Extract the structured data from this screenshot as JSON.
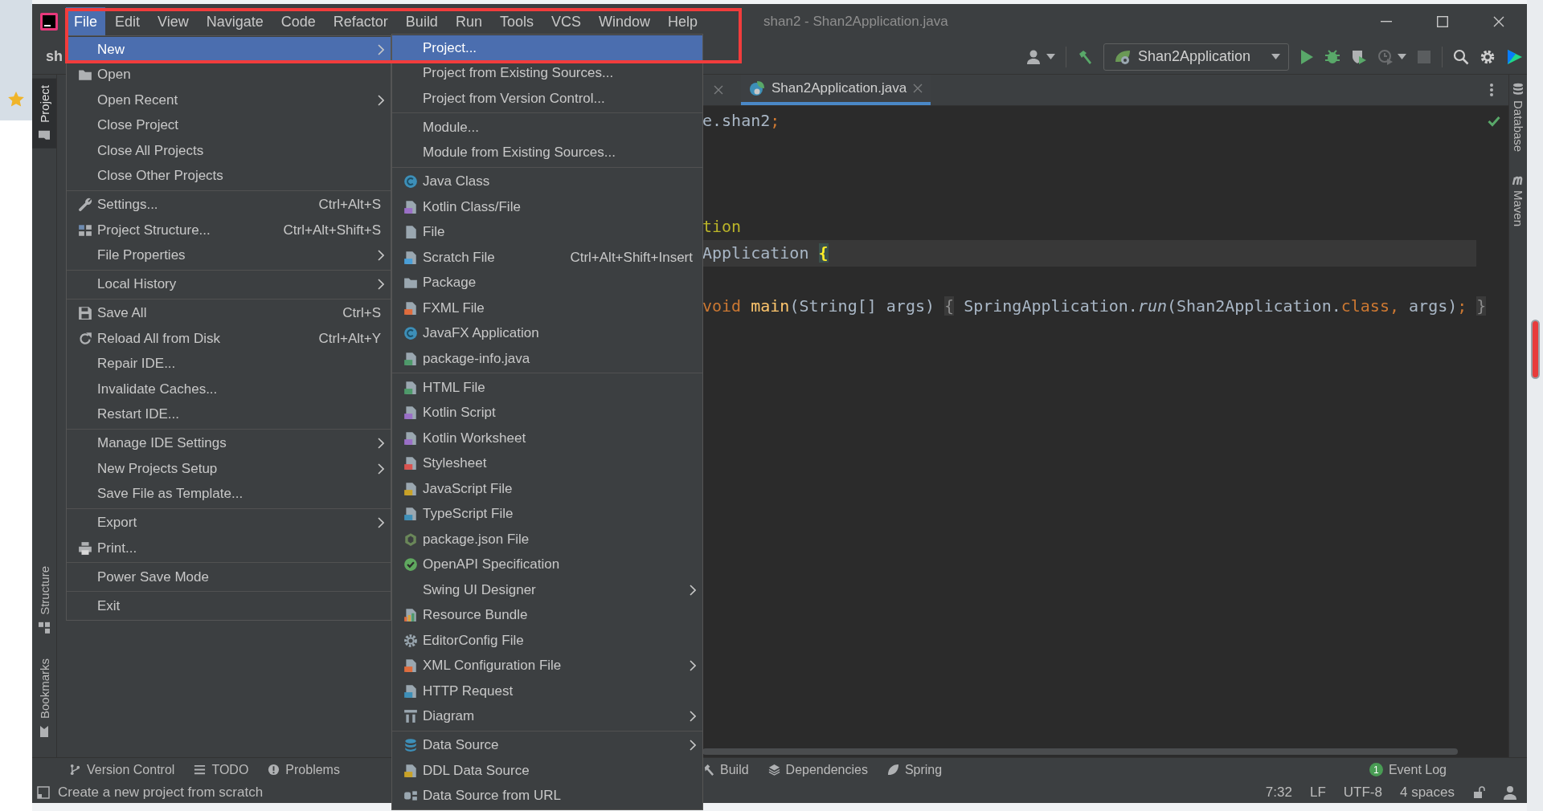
{
  "window": {
    "title": "shan2 - Shan2Application.java"
  },
  "menu_bar": [
    {
      "label": "File",
      "selected": true
    },
    {
      "label": "Edit",
      "selected": false
    },
    {
      "label": "View",
      "selected": false
    },
    {
      "label": "Navigate",
      "selected": false
    },
    {
      "label": "Code",
      "selected": false
    },
    {
      "label": "Refactor",
      "selected": false
    },
    {
      "label": "Build",
      "selected": false
    },
    {
      "label": "Run",
      "selected": false
    },
    {
      "label": "Tools",
      "selected": false
    },
    {
      "label": "VCS",
      "selected": false
    },
    {
      "label": "Window",
      "selected": false
    },
    {
      "label": "Help",
      "selected": false
    }
  ],
  "toolbar": {
    "project": "sh",
    "run_configuration": "Shan2Application"
  },
  "left_stripe": [
    {
      "label": "Project",
      "selected": true
    },
    {
      "label": "Structure",
      "selected": false
    },
    {
      "label": "Bookmarks",
      "selected": false
    }
  ],
  "right_stripe": [
    {
      "label": "Database"
    },
    {
      "label": "Maven"
    }
  ],
  "tabs": [
    {
      "label": "Shan2Application.java",
      "selected": true
    }
  ],
  "editor": {
    "lines": [
      {
        "current": false,
        "tokens": [
          {
            "text": "e.shan2",
            "kind": "plain"
          },
          {
            "text": ";",
            "kind": "keyword"
          }
        ]
      },
      {
        "current": false
      },
      {
        "current": false
      },
      {
        "current": false
      },
      {
        "current": false,
        "tokens": [
          {
            "text": "tion",
            "kind": "annotation"
          }
        ]
      },
      {
        "current": true,
        "tokens": [
          {
            "text": "Application ",
            "kind": "plain"
          },
          {
            "text": "{",
            "kind": "brace-match"
          }
        ]
      },
      {
        "current": false
      },
      {
        "current": false,
        "tokens": [
          {
            "text": "void ",
            "kind": "keyword"
          },
          {
            "text": "main",
            "kind": "method"
          },
          {
            "text": "(String[] args) ",
            "kind": "plain"
          },
          {
            "text": "{",
            "kind": "fold"
          },
          {
            "text": " SpringApplication.",
            "kind": "plain"
          },
          {
            "text": "run",
            "kind": "italic"
          },
          {
            "text": "(Shan2Application.",
            "kind": "plain"
          },
          {
            "text": "class, ",
            "kind": "keyword"
          },
          {
            "text": "args)",
            "kind": "plain"
          },
          {
            "text": "; ",
            "kind": "keyword"
          },
          {
            "text": "}",
            "kind": "fold"
          }
        ]
      }
    ]
  },
  "file_menu": {
    "items": [
      {
        "kind": "item",
        "label": "New",
        "has_submenu": true,
        "selected": true
      },
      {
        "kind": "item",
        "label": "Open",
        "has_submenu": false,
        "selected": false
      },
      {
        "kind": "item",
        "label": "Open Recent",
        "has_submenu": true,
        "selected": false
      },
      {
        "kind": "item",
        "label": "Close Project",
        "has_submenu": false,
        "selected": false
      },
      {
        "kind": "item",
        "label": "Close All Projects",
        "has_submenu": false,
        "selected": false
      },
      {
        "kind": "item",
        "label": "Close Other Projects",
        "has_submenu": false,
        "selected": false
      },
      {
        "kind": "separator"
      },
      {
        "kind": "item",
        "label": "Settings...",
        "shortcut": "Ctrl+Alt+S",
        "has_submenu": false,
        "selected": false
      },
      {
        "kind": "item",
        "label": "Project Structure...",
        "shortcut": "Ctrl+Alt+Shift+S",
        "has_submenu": false,
        "selected": false
      },
      {
        "kind": "item",
        "label": "File Properties",
        "has_submenu": true,
        "selected": false
      },
      {
        "kind": "separator"
      },
      {
        "kind": "item",
        "label": "Local History",
        "has_submenu": true,
        "selected": false
      },
      {
        "kind": "separator"
      },
      {
        "kind": "item",
        "label": "Save All",
        "shortcut": "Ctrl+S",
        "has_submenu": false,
        "selected": false
      },
      {
        "kind": "item",
        "label": "Reload All from Disk",
        "shortcut": "Ctrl+Alt+Y",
        "has_submenu": false,
        "selected": false
      },
      {
        "kind": "item",
        "label": "Repair IDE...",
        "has_submenu": false,
        "selected": false
      },
      {
        "kind": "item",
        "label": "Invalidate Caches...",
        "has_submenu": false,
        "selected": false
      },
      {
        "kind": "item",
        "label": "Restart IDE...",
        "has_submenu": false,
        "selected": false
      },
      {
        "kind": "separator"
      },
      {
        "kind": "item",
        "label": "Manage IDE Settings",
        "has_submenu": true,
        "selected": false
      },
      {
        "kind": "item",
        "label": "New Projects Setup",
        "has_submenu": true,
        "selected": false
      },
      {
        "kind": "item",
        "label": "Save File as Template...",
        "has_submenu": false,
        "selected": false
      },
      {
        "kind": "separator"
      },
      {
        "kind": "item",
        "label": "Export",
        "has_submenu": true,
        "selected": false
      },
      {
        "kind": "item",
        "label": "Print...",
        "has_submenu": false,
        "selected": false
      },
      {
        "kind": "separator"
      },
      {
        "kind": "item",
        "label": "Power Save Mode",
        "has_submenu": false,
        "selected": false
      },
      {
        "kind": "separator"
      },
      {
        "kind": "item",
        "label": "Exit",
        "has_submenu": false,
        "selected": false
      }
    ]
  },
  "new_submenu": {
    "items": [
      {
        "kind": "item",
        "label": "Project...",
        "has_submenu": false,
        "selected": true
      },
      {
        "kind": "item",
        "label": "Project from Existing Sources...",
        "has_submenu": false,
        "selected": false
      },
      {
        "kind": "item",
        "label": "Project from Version Control...",
        "has_submenu": false,
        "selected": false
      },
      {
        "kind": "separator"
      },
      {
        "kind": "item",
        "label": "Module...",
        "has_submenu": false,
        "selected": false
      },
      {
        "kind": "item",
        "label": "Module from Existing Sources...",
        "has_submenu": false,
        "selected": false
      },
      {
        "kind": "separator"
      },
      {
        "kind": "item",
        "label": "Java Class",
        "has_submenu": false,
        "selected": false
      },
      {
        "kind": "item",
        "label": "Kotlin Class/File",
        "has_submenu": false,
        "selected": false
      },
      {
        "kind": "item",
        "label": "File",
        "has_submenu": false,
        "selected": false
      },
      {
        "kind": "item",
        "label": "Scratch File",
        "shortcut": "Ctrl+Alt+Shift+Insert",
        "has_submenu": false,
        "selected": false
      },
      {
        "kind": "item",
        "label": "Package",
        "has_submenu": false,
        "selected": false
      },
      {
        "kind": "item",
        "label": "FXML File",
        "has_submenu": false,
        "selected": false
      },
      {
        "kind": "item",
        "label": "JavaFX Application",
        "has_submenu": false,
        "selected": false
      },
      {
        "kind": "item",
        "label": "package-info.java",
        "has_submenu": false,
        "selected": false
      },
      {
        "kind": "separator"
      },
      {
        "kind": "item",
        "label": "HTML File",
        "has_submenu": false,
        "selected": false
      },
      {
        "kind": "item",
        "label": "Kotlin Script",
        "has_submenu": false,
        "selected": false
      },
      {
        "kind": "item",
        "label": "Kotlin Worksheet",
        "has_submenu": false,
        "selected": false
      },
      {
        "kind": "item",
        "label": "Stylesheet",
        "has_submenu": false,
        "selected": false
      },
      {
        "kind": "item",
        "label": "JavaScript File",
        "has_submenu": false,
        "selected": false
      },
      {
        "kind": "item",
        "label": "TypeScript File",
        "has_submenu": false,
        "selected": false
      },
      {
        "kind": "item",
        "label": "package.json File",
        "has_submenu": false,
        "selected": false
      },
      {
        "kind": "item",
        "label": "OpenAPI Specification",
        "has_submenu": false,
        "selected": false
      },
      {
        "kind": "item",
        "label": "Swing UI Designer",
        "has_submenu": true,
        "selected": false
      },
      {
        "kind": "item",
        "label": "Resource Bundle",
        "has_submenu": false,
        "selected": false
      },
      {
        "kind": "item",
        "label": "EditorConfig File",
        "has_submenu": false,
        "selected": false
      },
      {
        "kind": "item",
        "label": "XML Configuration File",
        "has_submenu": true,
        "selected": false
      },
      {
        "kind": "item",
        "label": "HTTP Request",
        "has_submenu": false,
        "selected": false
      },
      {
        "kind": "item",
        "label": "Diagram",
        "has_submenu": true,
        "selected": false
      },
      {
        "kind": "separator"
      },
      {
        "kind": "item",
        "label": "Data Source",
        "has_submenu": true,
        "selected": false
      },
      {
        "kind": "item",
        "label": "DDL Data Source",
        "has_submenu": false,
        "selected": false
      },
      {
        "kind": "item",
        "label": "Data Source from URL",
        "has_submenu": false,
        "selected": false
      }
    ]
  },
  "tool_buttons_left": [
    {
      "label": "Version Control"
    },
    {
      "label": "TODO"
    },
    {
      "label": "Problems"
    }
  ],
  "tool_buttons_right": [
    {
      "label": "Build"
    },
    {
      "label": "Dependencies"
    },
    {
      "label": "Spring"
    }
  ],
  "event_log": {
    "label": "Event Log",
    "badge": "1"
  },
  "status_bar": {
    "message": "Create a new project from scratch",
    "widgets": [
      "7:32",
      "LF",
      "UTF-8",
      "4 spaces"
    ]
  }
}
